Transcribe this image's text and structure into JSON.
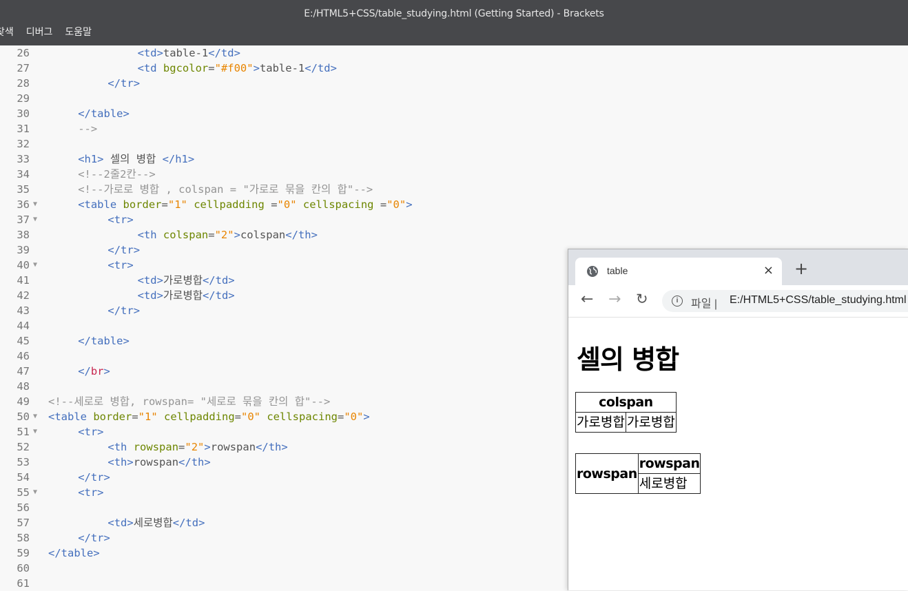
{
  "window": {
    "title": "E:/HTML5+CSS/table_studying.html (Getting Started) - Brackets"
  },
  "menu": [
    "찾색",
    "디버그",
    "도움말"
  ],
  "editor": {
    "lines": [
      {
        "n": "26",
        "fold": false,
        "indent": 12,
        "tokens": [
          [
            "t",
            "<td>"
          ],
          [
            "p",
            "table-1"
          ],
          [
            "t",
            "</td>"
          ]
        ]
      },
      {
        "n": "27",
        "fold": false,
        "indent": 12,
        "tokens": [
          [
            "t",
            "<td "
          ],
          [
            "a",
            "bgcolor"
          ],
          [
            "p",
            "="
          ],
          [
            "v",
            "\"#f00\""
          ],
          [
            "t",
            ">"
          ],
          [
            "p",
            "table-1"
          ],
          [
            "t",
            "</td>"
          ]
        ]
      },
      {
        "n": "28",
        "fold": false,
        "indent": 8,
        "tokens": [
          [
            "t",
            "</tr>"
          ]
        ]
      },
      {
        "n": "29",
        "fold": false,
        "indent": 0,
        "tokens": []
      },
      {
        "n": "30",
        "fold": false,
        "indent": 4,
        "tokens": [
          [
            "t",
            "</table>"
          ]
        ]
      },
      {
        "n": "31",
        "fold": false,
        "indent": 4,
        "tokens": [
          [
            "c",
            "-->"
          ]
        ]
      },
      {
        "n": "32",
        "fold": false,
        "indent": 0,
        "tokens": []
      },
      {
        "n": "33",
        "fold": false,
        "indent": 4,
        "tokens": [
          [
            "t",
            "<h1>"
          ],
          [
            "p",
            " 셀의 병합 "
          ],
          [
            "t",
            "</h1>"
          ]
        ]
      },
      {
        "n": "34",
        "fold": false,
        "indent": 4,
        "tokens": [
          [
            "c",
            "<!--2줄2칸-->"
          ]
        ]
      },
      {
        "n": "35",
        "fold": false,
        "indent": 4,
        "tokens": [
          [
            "c",
            "<!--가로로 병합 , colspan = \"가로로 묶을 칸의 합\"-->"
          ]
        ]
      },
      {
        "n": "36",
        "fold": true,
        "indent": 4,
        "tokens": [
          [
            "t",
            "<table "
          ],
          [
            "a",
            "border"
          ],
          [
            "p",
            "="
          ],
          [
            "v",
            "\"1\""
          ],
          [
            "a",
            " cellpadding "
          ],
          [
            "p",
            "="
          ],
          [
            "v",
            "\"0\""
          ],
          [
            "a",
            " cellspacing "
          ],
          [
            "p",
            "="
          ],
          [
            "v",
            "\"0\""
          ],
          [
            "t",
            ">"
          ]
        ]
      },
      {
        "n": "37",
        "fold": true,
        "indent": 8,
        "tokens": [
          [
            "t",
            "<tr>"
          ]
        ]
      },
      {
        "n": "38",
        "fold": false,
        "indent": 12,
        "tokens": [
          [
            "t",
            "<th "
          ],
          [
            "a",
            "colspan"
          ],
          [
            "p",
            "="
          ],
          [
            "v",
            "\"2\""
          ],
          [
            "t",
            ">"
          ],
          [
            "p",
            "colspan"
          ],
          [
            "t",
            "</th>"
          ]
        ]
      },
      {
        "n": "39",
        "fold": false,
        "indent": 8,
        "tokens": [
          [
            "t",
            "</tr>"
          ]
        ]
      },
      {
        "n": "40",
        "fold": true,
        "indent": 8,
        "tokens": [
          [
            "t",
            "<tr>"
          ]
        ]
      },
      {
        "n": "41",
        "fold": false,
        "indent": 12,
        "tokens": [
          [
            "t",
            "<td>"
          ],
          [
            "p",
            "가로병합"
          ],
          [
            "t",
            "</td>"
          ]
        ]
      },
      {
        "n": "42",
        "fold": false,
        "indent": 12,
        "tokens": [
          [
            "t",
            "<td>"
          ],
          [
            "p",
            "가로병합"
          ],
          [
            "t",
            "</td>"
          ]
        ]
      },
      {
        "n": "43",
        "fold": false,
        "indent": 8,
        "tokens": [
          [
            "t",
            "</tr>"
          ]
        ]
      },
      {
        "n": "44",
        "fold": false,
        "indent": 0,
        "tokens": []
      },
      {
        "n": "45",
        "fold": false,
        "indent": 4,
        "tokens": [
          [
            "t",
            "</table>"
          ]
        ]
      },
      {
        "n": "46",
        "fold": false,
        "indent": 0,
        "tokens": []
      },
      {
        "n": "47",
        "fold": false,
        "indent": 4,
        "tokens": [
          [
            "t",
            "</"
          ],
          [
            "br",
            "br"
          ],
          [
            "t",
            ">"
          ]
        ]
      },
      {
        "n": "48",
        "fold": false,
        "indent": 0,
        "tokens": []
      },
      {
        "n": "49",
        "fold": false,
        "indent": 0,
        "tokens": [
          [
            "c",
            "<!--세로로 병합, rowspan= \"세로로 묶을 칸의 합\"-->"
          ]
        ]
      },
      {
        "n": "50",
        "fold": true,
        "indent": 0,
        "tokens": [
          [
            "t",
            "<table "
          ],
          [
            "a",
            "border"
          ],
          [
            "p",
            "="
          ],
          [
            "v",
            "\"1\""
          ],
          [
            "a",
            " cellpadding"
          ],
          [
            "p",
            "="
          ],
          [
            "v",
            "\"0\""
          ],
          [
            "a",
            " cellspacing"
          ],
          [
            "p",
            "="
          ],
          [
            "v",
            "\"0\""
          ],
          [
            "t",
            ">"
          ]
        ]
      },
      {
        "n": "51",
        "fold": true,
        "indent": 4,
        "tokens": [
          [
            "t",
            "<tr>"
          ]
        ]
      },
      {
        "n": "52",
        "fold": false,
        "indent": 8,
        "tokens": [
          [
            "t",
            "<th "
          ],
          [
            "a",
            "rowspan"
          ],
          [
            "p",
            "="
          ],
          [
            "v",
            "\"2\""
          ],
          [
            "t",
            ">"
          ],
          [
            "p",
            "rowspan"
          ],
          [
            "t",
            "</th>"
          ]
        ]
      },
      {
        "n": "53",
        "fold": false,
        "indent": 8,
        "tokens": [
          [
            "t",
            "<th>"
          ],
          [
            "p",
            "rowspan"
          ],
          [
            "t",
            "</th>"
          ]
        ]
      },
      {
        "n": "54",
        "fold": false,
        "indent": 4,
        "tokens": [
          [
            "t",
            "</tr>"
          ]
        ]
      },
      {
        "n": "55",
        "fold": true,
        "indent": 4,
        "tokens": [
          [
            "t",
            "<tr>"
          ]
        ]
      },
      {
        "n": "56",
        "fold": false,
        "indent": 0,
        "tokens": []
      },
      {
        "n": "57",
        "fold": false,
        "indent": 8,
        "tokens": [
          [
            "t",
            "<td>"
          ],
          [
            "p",
            "세로병합"
          ],
          [
            "t",
            "</td>"
          ]
        ]
      },
      {
        "n": "58",
        "fold": false,
        "indent": 4,
        "tokens": [
          [
            "t",
            "</tr>"
          ]
        ]
      },
      {
        "n": "59",
        "fold": false,
        "indent": 0,
        "tokens": [
          [
            "t",
            "</table>"
          ]
        ]
      },
      {
        "n": "60",
        "fold": false,
        "indent": 0,
        "tokens": []
      },
      {
        "n": "61",
        "fold": false,
        "indent": 0,
        "tokens": []
      }
    ]
  },
  "browser": {
    "tab_title": "table",
    "tab_close": "×",
    "new_tab": "+",
    "url_prefix": "파일 |",
    "url": "E:/HTML5+CSS/table_studying.html",
    "page": {
      "heading": "셀의 병합",
      "table1": {
        "header": "colspan",
        "cells": [
          "가로병합",
          "가로병합"
        ]
      },
      "table2": {
        "row_header": "rowspan",
        "col_header": "rowspan",
        "cell": "세로병합"
      }
    }
  }
}
